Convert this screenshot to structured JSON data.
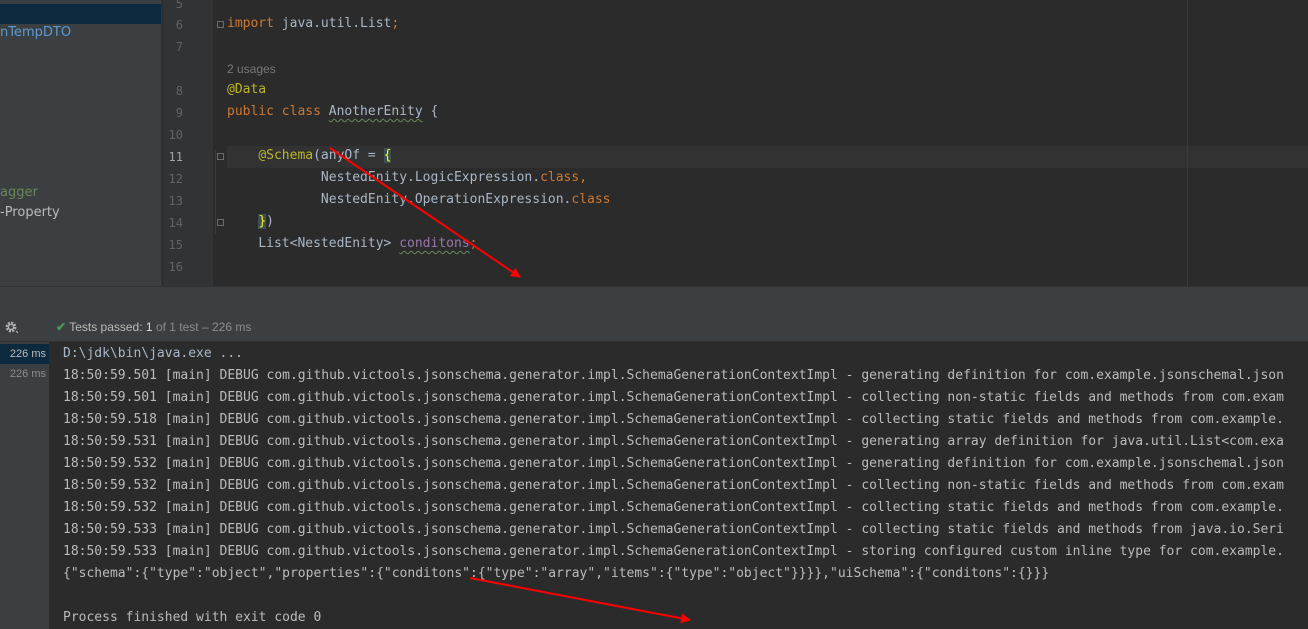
{
  "project_tree": {
    "items": [
      "nTempDTO",
      "agger",
      "-Property"
    ]
  },
  "editor": {
    "line_numbers": [
      "5",
      "6",
      "7",
      "8",
      "9",
      "10",
      "11",
      "12",
      "13",
      "14",
      "15",
      "16"
    ],
    "usages_hint": "2 usages",
    "code": {
      "l6_kw": "import",
      "l6_rest": " java.util.List",
      "l6_semi": ";",
      "l8_ann": "@Data",
      "l9_kw": "public class",
      "l9_sp": " ",
      "l9_name": "AnotherEnity",
      "l9_rest": " {",
      "l11_ann": "@Schema",
      "l11_mid": "(anyOf = ",
      "l11_brace": "{",
      "l12_text": "NestedEnity.LogicExpression.",
      "l12_kw": "class,",
      "l13_text": "NestedEnity.OperationExpression.",
      "l13_kw": "class",
      "l14_brace": "}",
      "l14_rest": ")",
      "l15_type": "List<NestedEnity> ",
      "l15_field": "conditons",
      "l15_semi": ";"
    }
  },
  "run_panel": {
    "check_icon": "✔",
    "status_label": "Tests passed:",
    "status_count": "1",
    "status_rest": "of 1 test – 226 ms",
    "test_rows": [
      "226 ms",
      "226 ms"
    ],
    "console_lines": [
      "D:\\jdk\\bin\\java.exe ...",
      "18:50:59.501 [main] DEBUG com.github.victools.jsonschema.generator.impl.SchemaGenerationContextImpl - generating definition for com.example.jsonschemal.json",
      "18:50:59.501 [main] DEBUG com.github.victools.jsonschema.generator.impl.SchemaGenerationContextImpl - collecting non-static fields and methods from com.exam",
      "18:50:59.518 [main] DEBUG com.github.victools.jsonschema.generator.impl.SchemaGenerationContextImpl - collecting static fields and methods from com.example.",
      "18:50:59.531 [main] DEBUG com.github.victools.jsonschema.generator.impl.SchemaGenerationContextImpl - generating array definition for java.util.List<com.exa",
      "18:50:59.532 [main] DEBUG com.github.victools.jsonschema.generator.impl.SchemaGenerationContextImpl - generating definition for com.example.jsonschemal.json",
      "18:50:59.532 [main] DEBUG com.github.victools.jsonschema.generator.impl.SchemaGenerationContextImpl - collecting non-static fields and methods from com.exam",
      "18:50:59.532 [main] DEBUG com.github.victools.jsonschema.generator.impl.SchemaGenerationContextImpl - collecting static fields and methods from com.example.",
      "18:50:59.533 [main] DEBUG com.github.victools.jsonschema.generator.impl.SchemaGenerationContextImpl - collecting static fields and methods from java.io.Seri",
      "18:50:59.533 [main] DEBUG com.github.victools.jsonschema.generator.impl.SchemaGenerationContextImpl - storing configured custom inline type for com.example.",
      "{\"schema\":{\"type\":\"object\",\"properties\":{\"conditons\":{\"type\":\"array\",\"items\":{\"type\":\"object\"}}}},\"uiSchema\":{\"conditons\":{}}}",
      "",
      "Process finished with exit code 0"
    ]
  },
  "colors": {
    "annotation_arrow": "#ff0000",
    "keyword": "#cc7832",
    "annotation": "#bbb529",
    "field": "#9876aa",
    "test_pass": "#499c54"
  }
}
